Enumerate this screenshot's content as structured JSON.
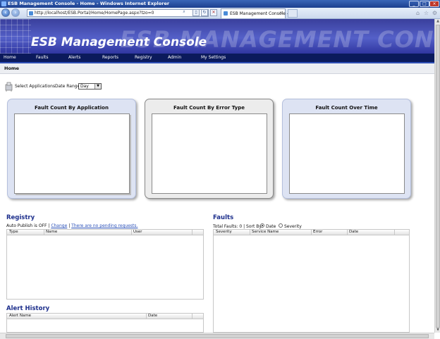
{
  "window": {
    "title": "ESB Management Console - Home - Windows Internet Explorer",
    "min_label": "_",
    "max_label": "□",
    "close_label": "×"
  },
  "browser": {
    "back_glyph": "‹",
    "forward_glyph": "›",
    "address_url": "http://localhost/ESB.Portal/Home/HomePage.aspx?tzo=0",
    "tab_title": "ESB Management Console - ...",
    "tab_close": "×",
    "search_glyph": "⌕",
    "refresh_glyph": "↻",
    "stop_glyph": "✕",
    "compat_glyph": "▯",
    "home_glyph": "⌂",
    "favorites_glyph": "☆",
    "tools_glyph": "⚙"
  },
  "banner": {
    "title": "ESB Management Console",
    "watermark": "ESB MANAGEMENT CONSOLE"
  },
  "nav": {
    "items": [
      {
        "label": "Home"
      },
      {
        "label": "Faults"
      },
      {
        "label": "Alerts"
      },
      {
        "label": "Reports"
      },
      {
        "label": "Registry"
      },
      {
        "label": "Admin"
      },
      {
        "label": "My Settings"
      }
    ]
  },
  "breadcrumb": {
    "label": "Home"
  },
  "filters": {
    "select_applications": "Select Applications",
    "date_range_label": "Date Range:",
    "date_range_value": "Day"
  },
  "panels": [
    {
      "title": "Fault Count By Application"
    },
    {
      "title": "Fault Count By Error Type"
    },
    {
      "title": "Fault Count Over Time"
    }
  ],
  "registry": {
    "heading": "Registry",
    "auto_publish": "Auto Publish is OFF |",
    "change_link": "Change",
    "separator": "|",
    "pending_link": "There are no pending requests.",
    "columns": [
      "Type",
      "Name",
      "User"
    ]
  },
  "faults": {
    "heading": "Faults",
    "total_label": "Total Faults: 0 | Sort By:",
    "sort_options": [
      {
        "label": "Date",
        "selected": true
      },
      {
        "label": "Severity",
        "selected": false
      }
    ],
    "columns": [
      "Severity",
      "Service Name",
      "Error",
      "Date"
    ]
  },
  "alert_history": {
    "heading": "Alert History",
    "columns": [
      "Alert Name",
      "Date"
    ]
  },
  "colors": {
    "banner": "#4a52b8",
    "navbar": "#0b1a5c",
    "heading": "#1d2f8c",
    "link": "#2a50b8"
  }
}
